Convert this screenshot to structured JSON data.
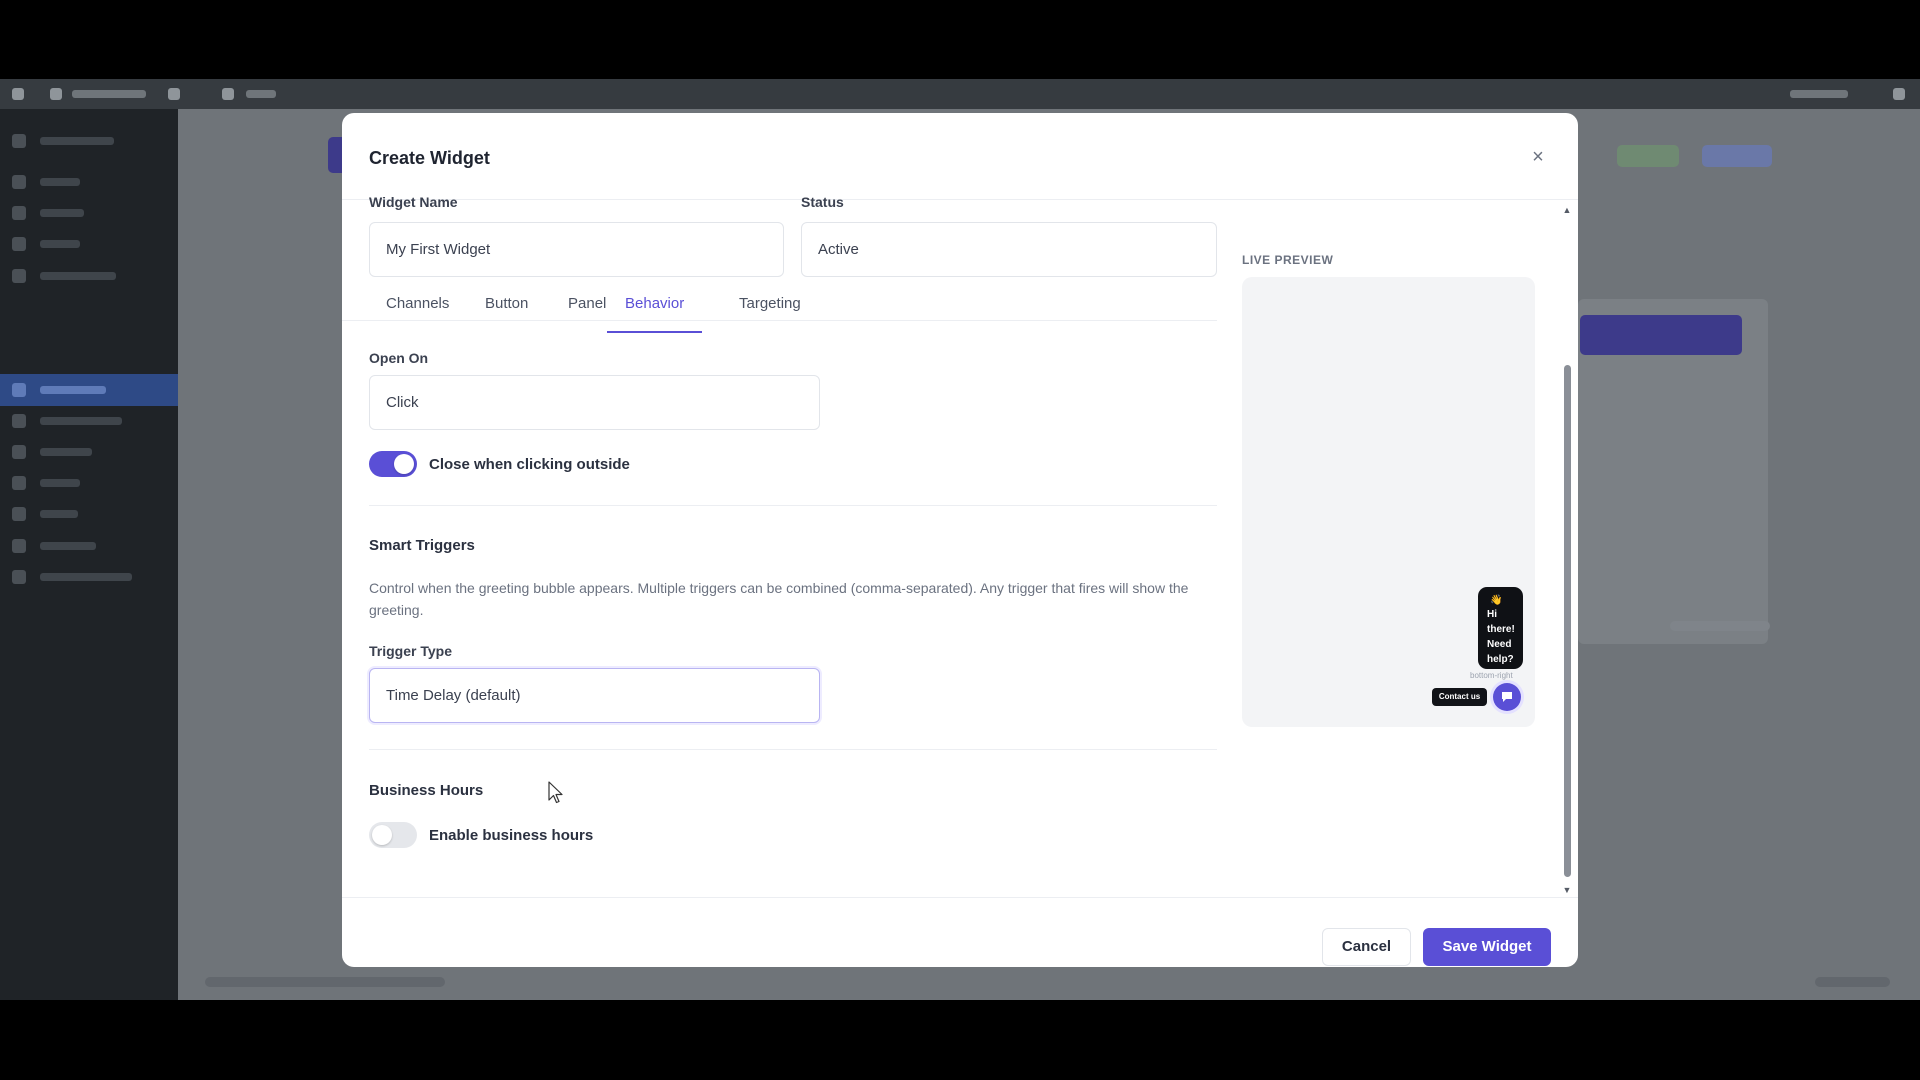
{
  "modal": {
    "title": "Create Widget",
    "close_icon": "×"
  },
  "fields": {
    "widget_name": {
      "label": "Widget Name",
      "value": "My First Widget"
    },
    "status": {
      "label": "Status",
      "value": "Active"
    }
  },
  "tabs": [
    {
      "label": "Channels"
    },
    {
      "label": "Button"
    },
    {
      "label": "Panel"
    },
    {
      "label": "Behavior",
      "active": true
    },
    {
      "label": "Targeting"
    }
  ],
  "behavior": {
    "open_on": {
      "label": "Open On",
      "value": "Click"
    },
    "close_outside": {
      "label": "Close when clicking outside",
      "enabled": true
    },
    "smart_triggers": {
      "title": "Smart Triggers",
      "help": "Control when the greeting bubble appears. Multiple triggers can be combined (comma-separated). Any trigger that fires will show the greeting.",
      "trigger_type": {
        "label": "Trigger Type",
        "value": "Time Delay (default)"
      }
    },
    "business_hours": {
      "title": "Business Hours",
      "toggle_label": "Enable business hours",
      "enabled": false
    }
  },
  "preview": {
    "label": "LIVE PREVIEW",
    "greeting_emoji": "👋",
    "greeting": "Hi there! Need help?",
    "position": "bottom-right",
    "contact_label": "Contact us"
  },
  "footer": {
    "cancel": "Cancel",
    "save": "Save Widget"
  },
  "colors": {
    "accent": "#5a4fd6",
    "overlay": "#6f7479"
  }
}
